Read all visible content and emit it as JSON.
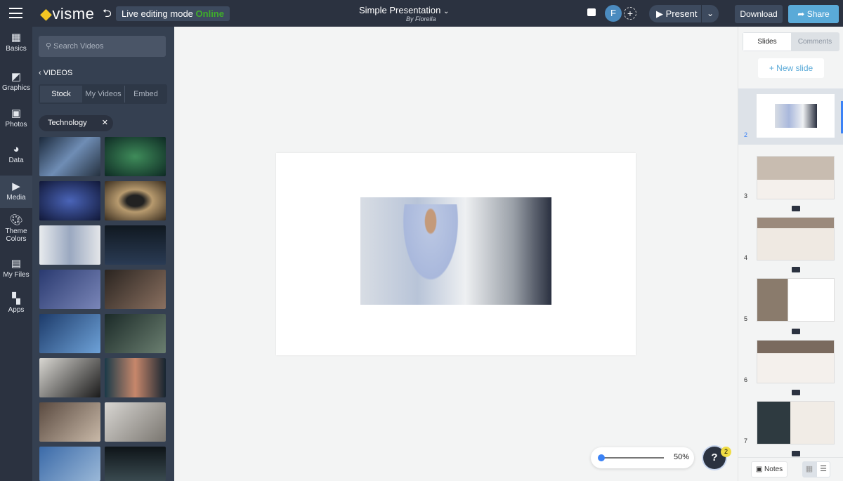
{
  "header": {
    "brand": "visme",
    "live_label": "Live editing mode",
    "live_status": "Online",
    "title": "Simple Presentation",
    "subtitle": "By Fiorella",
    "avatar": "F",
    "present": "Present",
    "download": "Download",
    "share": "Share"
  },
  "rail": [
    {
      "label": "Basics",
      "icon": "abc-blocks-icon"
    },
    {
      "label": "Graphics",
      "icon": "graphics-icon"
    },
    {
      "label": "Photos",
      "icon": "photo-icon"
    },
    {
      "label": "Data",
      "icon": "pie-chart-icon"
    },
    {
      "label": "Media",
      "icon": "media-icon"
    },
    {
      "label": "Theme Colors",
      "icon": "palette-icon"
    },
    {
      "label": "My Files",
      "icon": "folder-icon"
    },
    {
      "label": "Apps",
      "icon": "apps-icon"
    }
  ],
  "panel": {
    "search_placeholder": "Search Videos",
    "back": "VIDEOS",
    "tabs": [
      "Stock",
      "My Videos",
      "Embed"
    ],
    "filter": "Technology"
  },
  "right": {
    "tabs": [
      "Slides",
      "Comments"
    ],
    "new_slide": "+ New slide",
    "slides": [
      "2",
      "3",
      "4",
      "5",
      "6",
      "7"
    ],
    "notes": "Notes"
  },
  "zoom": {
    "value": "50%",
    "level": 0.5
  },
  "help": {
    "label": "?",
    "badge": "2"
  },
  "colors": {
    "accent": "#5aaad8",
    "online": "#3fae2a",
    "dark": "#2b3240"
  }
}
